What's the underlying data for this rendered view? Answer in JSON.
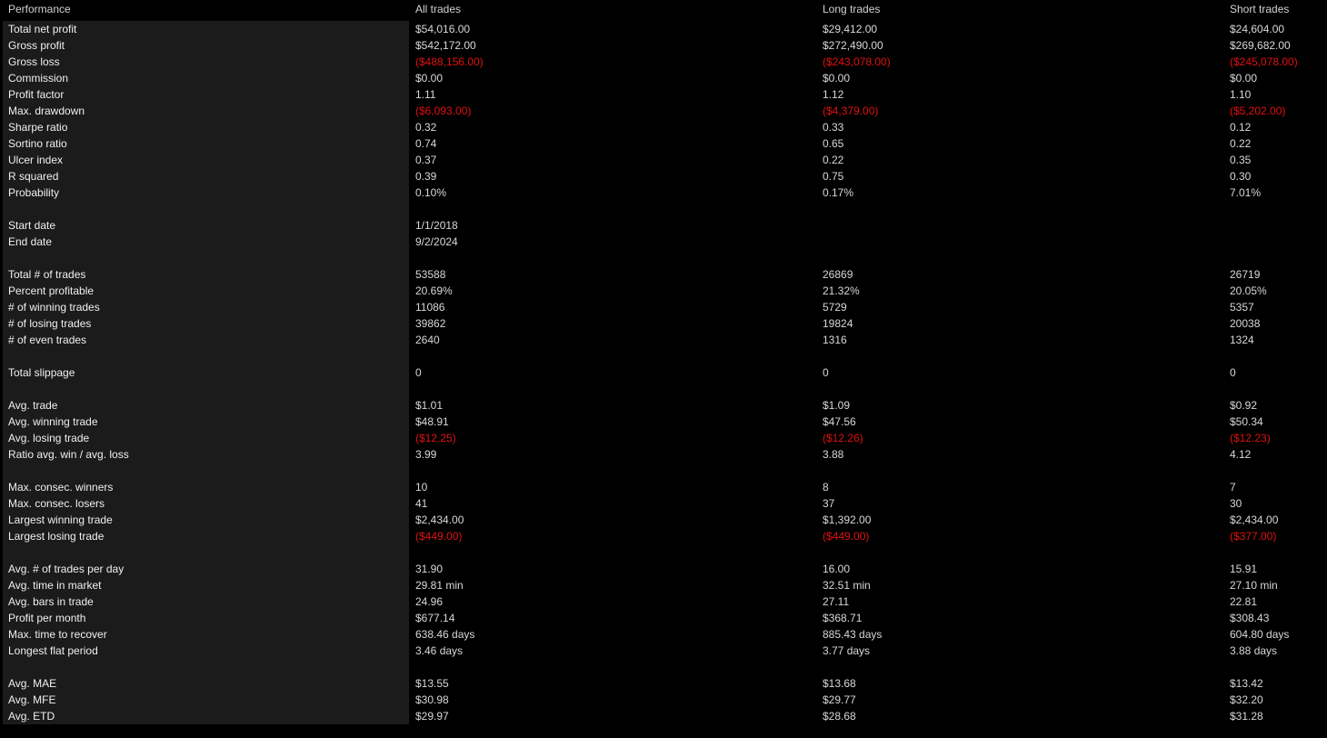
{
  "header": {
    "performance": "Performance",
    "all_trades": "All trades",
    "long_trades": "Long trades",
    "short_trades": "Short trades"
  },
  "colors": {
    "negative": "#e01010",
    "background": "#000000",
    "label_panel": "#1b1b1b"
  },
  "rows": [
    {
      "label": "Total net profit",
      "all": "$54,016.00",
      "long": "$29,412.00",
      "short": "$24,604.00"
    },
    {
      "label": "Gross profit",
      "all": "$542,172.00",
      "long": "$272,490.00",
      "short": "$269,682.00"
    },
    {
      "label": "Gross loss",
      "all": "($488,156.00)",
      "long": "($243,078.00)",
      "short": "($245,078.00)",
      "negative": true
    },
    {
      "label": "Commission",
      "all": "$0.00",
      "long": "$0.00",
      "short": "$0.00"
    },
    {
      "label": "Profit factor",
      "all": "1.11",
      "long": "1.12",
      "short": "1.10"
    },
    {
      "label": "Max. drawdown",
      "all": "($6,093.00)",
      "long": "($4,379.00)",
      "short": "($5,202.00)",
      "negative": true
    },
    {
      "label": "Sharpe ratio",
      "all": "0.32",
      "long": "0.33",
      "short": "0.12"
    },
    {
      "label": "Sortino ratio",
      "all": "0.74",
      "long": "0.65",
      "short": "0.22"
    },
    {
      "label": "Ulcer index",
      "all": "0.37",
      "long": "0.22",
      "short": "0.35"
    },
    {
      "label": "R squared",
      "all": "0.39",
      "long": "0.75",
      "short": "0.30"
    },
    {
      "label": "Probability",
      "all": "0.10%",
      "long": "0.17%",
      "short": "7.01%"
    },
    {
      "spacer": true
    },
    {
      "label": "Start date",
      "all": "1/1/2018",
      "long": "",
      "short": ""
    },
    {
      "label": "End date",
      "all": "9/2/2024",
      "long": "",
      "short": ""
    },
    {
      "spacer": true
    },
    {
      "label": "Total # of trades",
      "all": "53588",
      "long": "26869",
      "short": "26719"
    },
    {
      "label": "Percent profitable",
      "all": "20.69%",
      "long": "21.32%",
      "short": "20.05%"
    },
    {
      "label": "# of winning trades",
      "all": "11086",
      "long": "5729",
      "short": "5357"
    },
    {
      "label": "# of losing trades",
      "all": "39862",
      "long": "19824",
      "short": "20038"
    },
    {
      "label": "# of even trades",
      "all": "2640",
      "long": "1316",
      "short": "1324"
    },
    {
      "spacer": true
    },
    {
      "label": "Total slippage",
      "all": "0",
      "long": "0",
      "short": "0"
    },
    {
      "spacer": true
    },
    {
      "label": "Avg. trade",
      "all": "$1.01",
      "long": "$1.09",
      "short": "$0.92"
    },
    {
      "label": "Avg. winning trade",
      "all": "$48.91",
      "long": "$47.56",
      "short": "$50.34"
    },
    {
      "label": "Avg. losing trade",
      "all": "($12.25)",
      "long": "($12.26)",
      "short": "($12.23)",
      "negative": true
    },
    {
      "label": "Ratio avg. win / avg. loss",
      "all": "3.99",
      "long": "3.88",
      "short": "4.12"
    },
    {
      "spacer": true
    },
    {
      "label": "Max. consec. winners",
      "all": "10",
      "long": "8",
      "short": "7"
    },
    {
      "label": "Max. consec. losers",
      "all": "41",
      "long": "37",
      "short": "30"
    },
    {
      "label": "Largest winning trade",
      "all": "$2,434.00",
      "long": "$1,392.00",
      "short": "$2,434.00"
    },
    {
      "label": "Largest losing trade",
      "all": "($449.00)",
      "long": "($449.00)",
      "short": "($377.00)",
      "negative": true
    },
    {
      "spacer": true
    },
    {
      "label": "Avg. # of trades per day",
      "all": "31.90",
      "long": "16.00",
      "short": "15.91"
    },
    {
      "label": "Avg. time in market",
      "all": "29.81 min",
      "long": "32.51 min",
      "short": "27.10 min"
    },
    {
      "label": "Avg. bars in trade",
      "all": "24.96",
      "long": "27.11",
      "short": "22.81"
    },
    {
      "label": "Profit per month",
      "all": "$677.14",
      "long": "$368.71",
      "short": "$308.43"
    },
    {
      "label": "Max. time to recover",
      "all": "638.46 days",
      "long": "885.43 days",
      "short": "604.80 days"
    },
    {
      "label": "Longest flat period",
      "all": "3.46 days",
      "long": "3.77 days",
      "short": "3.88 days"
    },
    {
      "spacer": true
    },
    {
      "label": "Avg. MAE",
      "all": "$13.55",
      "long": "$13.68",
      "short": "$13.42"
    },
    {
      "label": "Avg. MFE",
      "all": "$30.98",
      "long": "$29.77",
      "short": "$32.20"
    },
    {
      "label": "Avg. ETD",
      "all": "$29.97",
      "long": "$28.68",
      "short": "$31.28"
    }
  ]
}
